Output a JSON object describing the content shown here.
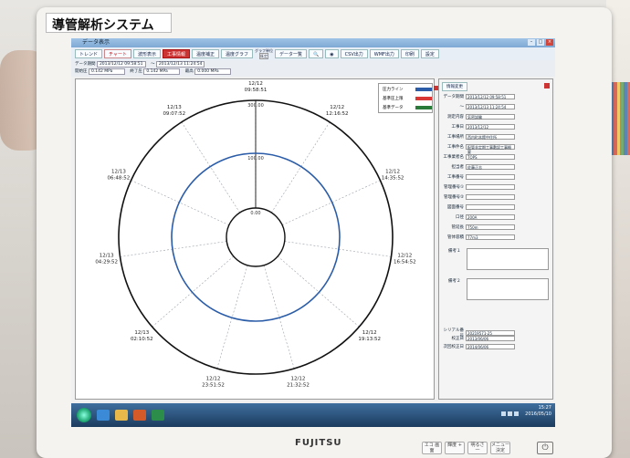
{
  "sticker": {
    "title": "導管解析システム"
  },
  "window": {
    "title": "データ表示"
  },
  "toolbar": {
    "buttons": [
      "トレンド",
      "チャート",
      "波形表示",
      "工事情報",
      "温度補正",
      "温度グラフ"
    ],
    "unit_group": "グラフ単位",
    "unit_value": "既定",
    "data_btn": "データ一覧",
    "csv": "CSV出力",
    "wmf": "WMF出力",
    "print": "印刷",
    "settings": "設定"
  },
  "info": {
    "label_period": "データ期間",
    "start": "2013/12/12 09:58:51",
    "sep": "〜",
    "end": "2013/12/13 11:24:54",
    "label_open": "開始圧",
    "open_val": "0.142 MPa",
    "label_close": "終了圧",
    "close_val": "0.142 MPa",
    "label_max": "最高",
    "max_val": "0.000 MPa"
  },
  "plot": {
    "legend": [
      {
        "label": "圧力ライン",
        "color": "#2b5ca8"
      },
      {
        "label": "基準圧上限",
        "color": "#d93636"
      },
      {
        "label": "基準データ",
        "color": "#2a7a3a"
      }
    ],
    "ring_labels": {
      "outer": "300.00",
      "middle": "100.00",
      "inner": "0.00"
    },
    "time_labels": [
      {
        "d": "12/12",
        "t": "09:58:51"
      },
      {
        "d": "12/12",
        "t": "12:16:52"
      },
      {
        "d": "12/12",
        "t": "14:35:52"
      },
      {
        "d": "12/12",
        "t": "16:54:52"
      },
      {
        "d": "12/12",
        "t": "19:13:52"
      },
      {
        "d": "12/12",
        "t": "21:32:52"
      },
      {
        "d": "12/12",
        "t": "23:51:52"
      },
      {
        "d": "12/13",
        "t": "02:10:52"
      },
      {
        "d": "12/13",
        "t": "04:29:52"
      },
      {
        "d": "12/13",
        "t": "06:48:52"
      },
      {
        "d": "12/13",
        "t": "09:07:52"
      }
    ],
    "colors": {
      "outer": "#111111",
      "middle": "#2b5ca8",
      "inner": "#111111",
      "grid": "#9aa0a8"
    }
  },
  "details": {
    "header_btn": "情報変更",
    "rows": [
      {
        "label": "データ期間",
        "value": "2013/12/12 09:58:51"
      },
      {
        "label": "〜",
        "value": "2013/12/13 11:24:54"
      },
      {
        "label": "測定内容",
        "value": "気密試験"
      },
      {
        "label": "工事日",
        "value": "2013/12/12"
      },
      {
        "label": "工事場所",
        "value": "西内町本館中住所"
      },
      {
        "label": "工事件名",
        "value": "配管非定期工事敷設工事概要"
      },
      {
        "label": "工事業者名",
        "value": "TOPS"
      },
      {
        "label": "担当者",
        "value": "佐藤正志"
      },
      {
        "label": "工事番号",
        "value": ""
      },
      {
        "label": "管理番号①",
        "value": ""
      },
      {
        "label": "管理番号②",
        "value": ""
      },
      {
        "label": "図面番号",
        "value": ""
      },
      {
        "label": "口径",
        "value": "200A"
      },
      {
        "label": "管延長",
        "value": "750m"
      },
      {
        "label": "管体容積",
        "value": "77m3"
      }
    ],
    "note1": "備考１",
    "note2": "備考２",
    "footer": [
      {
        "label": "シリアル番号",
        "value": "20219571-25"
      },
      {
        "label": "校正日",
        "value": "2013/06/06"
      },
      {
        "label": "次回校正日",
        "value": "2014/06/06"
      }
    ]
  },
  "taskbar": {
    "time": "15:27",
    "date": "2016/05/10"
  },
  "monitor": {
    "brand": "FUJITSU",
    "buttons": [
      "エコ 画面",
      "輝度 +",
      "明るさ 一",
      "メニュー 決定"
    ]
  }
}
